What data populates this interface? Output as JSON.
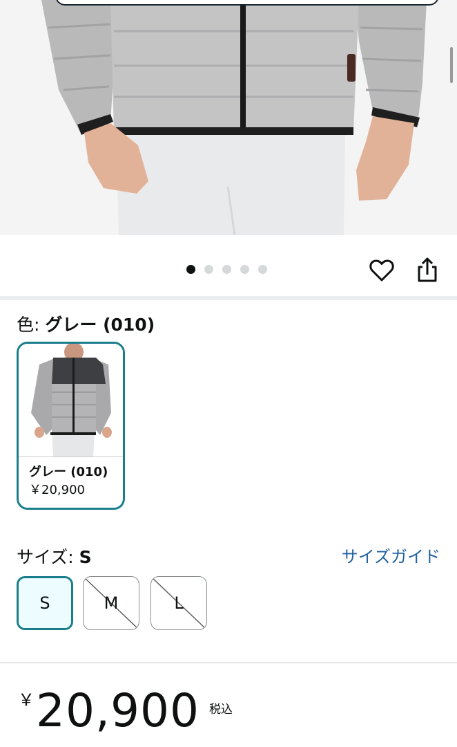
{
  "product": {
    "image_alt": "gray-down-jacket-photo",
    "carousel": {
      "total": 5,
      "active": 0
    },
    "actions": [
      "heart-icon",
      "share-icon"
    ]
  },
  "color": {
    "label": "色: ",
    "value": "グレー (010)",
    "swatches": [
      {
        "name": "グレー (010)",
        "price": "￥20,900",
        "selected": true
      }
    ]
  },
  "size": {
    "label": "サイズ: ",
    "value": "S",
    "guide_link": "サイズガイド",
    "options": [
      {
        "label": "S",
        "selected": true,
        "available": true
      },
      {
        "label": "M",
        "selected": false,
        "available": false
      },
      {
        "label": "L",
        "selected": false,
        "available": false
      }
    ]
  },
  "price": {
    "currency": "￥",
    "amount": "20,900",
    "tax_note": "税込"
  },
  "colors": {
    "accent_teal": "#1a7d8c",
    "link_blue": "#2162a1",
    "selected_bg": "#edfdff"
  }
}
